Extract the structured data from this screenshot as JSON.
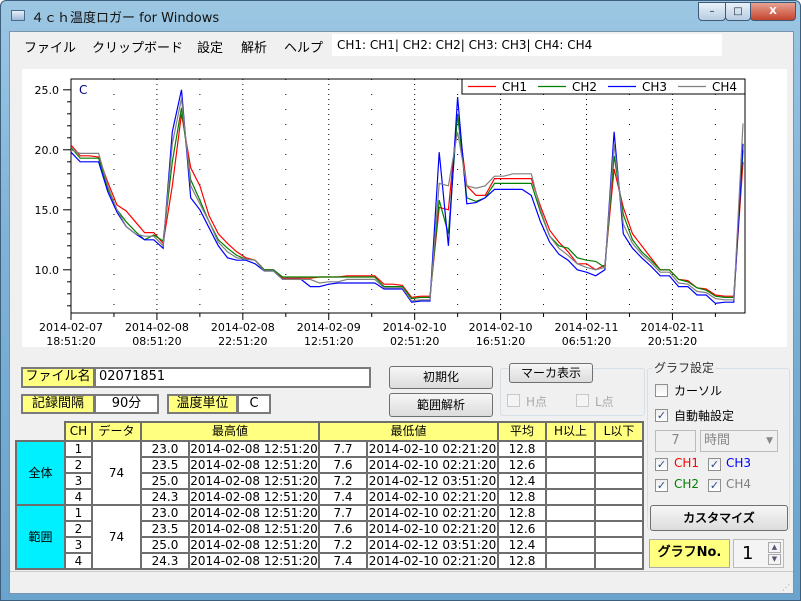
{
  "window": {
    "title": "４ｃｈ温度ロガー for Windows",
    "minimize": "–",
    "maximize": "□",
    "close": "X"
  },
  "menu": {
    "items": [
      "ファイル",
      "クリップボード",
      "設定",
      "解析",
      "ヘルプ"
    ],
    "channel_info": "CH1: CH1| CH2: CH2| CH3: CH3| CH4: CH4"
  },
  "chart_data": {
    "type": "line",
    "ylabel": "C",
    "ylim": [
      6.4,
      25.9
    ],
    "yticks": [
      "25.0",
      "20.0",
      "15.0",
      "10.0"
    ],
    "ytick_values": [
      25,
      20,
      15,
      10
    ],
    "x_start": "2014-02-07 18:51:20",
    "interval_minutes": 90,
    "xticks": [
      [
        "2014-02-07",
        "18:51:20"
      ],
      [
        "2014-02-08",
        "08:51:20"
      ],
      [
        "2014-02-08",
        "22:51:20"
      ],
      [
        "2014-02-09",
        "12:51:20"
      ],
      [
        "2014-02-10",
        "02:51:20"
      ],
      [
        "2014-02-10",
        "16:51:20"
      ],
      [
        "2014-02-11",
        "06:51:20"
      ],
      [
        "2014-02-11",
        "20:51:20"
      ]
    ],
    "grid": "vertical dotted",
    "legend": "top-right",
    "series": [
      {
        "name": "CH1",
        "color": "#ff0000",
        "values": [
          20.4,
          19.5,
          19.5,
          19.4,
          17.3,
          15.4,
          14.9,
          14.0,
          13.1,
          13.1,
          12.2,
          17.0,
          23.0,
          18.5,
          17.0,
          14.5,
          13.0,
          12.2,
          11.5,
          11.0,
          10.8,
          10.0,
          10.0,
          9.3,
          9.3,
          9.3,
          9.3,
          9.4,
          9.4,
          9.4,
          9.5,
          9.5,
          9.5,
          9.5,
          8.8,
          8.8,
          8.7,
          7.7,
          7.8,
          7.8,
          15.2,
          15.0,
          22.9,
          17.0,
          16.2,
          16.2,
          17.6,
          17.6,
          17.6,
          17.6,
          17.6,
          15.3,
          13.3,
          12.3,
          11.5,
          10.5,
          10.5,
          10.0,
          10.4,
          18.4,
          15.2,
          13.0,
          12.0,
          11.0,
          10.0,
          10.0,
          9.2,
          9.1,
          8.5,
          8.4,
          7.9,
          7.8,
          7.8,
          19.0
        ]
      },
      {
        "name": "CH2",
        "color": "#008000",
        "values": [
          20.2,
          19.3,
          19.3,
          19.3,
          16.8,
          15.0,
          14.0,
          13.2,
          12.5,
          12.9,
          12.4,
          19.0,
          23.5,
          17.5,
          15.8,
          14.0,
          12.5,
          11.8,
          11.2,
          10.9,
          10.8,
          10.0,
          10.0,
          9.4,
          9.4,
          9.4,
          9.4,
          9.4,
          9.4,
          9.4,
          9.4,
          9.4,
          9.4,
          9.4,
          8.6,
          8.6,
          8.6,
          7.6,
          7.7,
          7.7,
          15.8,
          13.0,
          23.0,
          16.0,
          15.7,
          16.0,
          17.2,
          17.2,
          17.2,
          17.2,
          17.2,
          14.8,
          12.8,
          12.0,
          11.8,
          11.0,
          10.8,
          10.7,
          10.2,
          19.5,
          14.6,
          12.5,
          11.5,
          10.8,
          10.0,
          10.0,
          9.2,
          9.0,
          8.5,
          8.3,
          7.8,
          7.7,
          7.7,
          20.0
        ]
      },
      {
        "name": "CH3",
        "color": "#0000ff",
        "values": [
          19.8,
          19.0,
          19.0,
          19.0,
          16.5,
          14.8,
          13.6,
          13.0,
          12.5,
          12.5,
          11.8,
          21.5,
          25.0,
          16.0,
          15.0,
          13.5,
          12.0,
          11.0,
          10.8,
          10.8,
          10.5,
          9.9,
          9.9,
          9.2,
          9.2,
          9.2,
          8.6,
          8.6,
          8.8,
          8.9,
          8.9,
          8.9,
          8.9,
          8.9,
          8.4,
          8.4,
          8.4,
          7.3,
          7.4,
          7.4,
          19.8,
          12.0,
          24.4,
          15.5,
          15.6,
          16.0,
          16.7,
          16.7,
          16.7,
          16.7,
          16.2,
          14.0,
          12.3,
          11.3,
          10.8,
          10.0,
          9.8,
          9.5,
          10.0,
          21.5,
          13.0,
          11.8,
          11.0,
          10.3,
          9.5,
          9.5,
          8.6,
          8.6,
          7.9,
          7.9,
          7.2,
          7.3,
          7.3,
          20.5
        ]
      },
      {
        "name": "CH4",
        "color": "#808080",
        "values": [
          20.0,
          19.7,
          19.7,
          19.7,
          17.0,
          15.0,
          13.6,
          13.0,
          12.8,
          12.8,
          12.0,
          20.5,
          24.3,
          17.0,
          15.5,
          14.0,
          12.3,
          11.5,
          11.0,
          10.9,
          10.8,
          9.9,
          9.9,
          9.2,
          9.2,
          9.2,
          9.2,
          8.9,
          9.0,
          9.0,
          9.2,
          9.2,
          9.2,
          9.2,
          8.5,
          8.5,
          8.5,
          7.4,
          7.5,
          7.5,
          17.2,
          17.0,
          21.5,
          17.0,
          16.8,
          17.0,
          17.8,
          17.8,
          18.0,
          18.0,
          18.0,
          15.0,
          12.8,
          11.8,
          11.2,
          10.5,
          10.2,
          10.0,
          10.2,
          20.5,
          13.8,
          12.2,
          11.3,
          10.6,
          9.8,
          9.8,
          8.9,
          8.8,
          8.2,
          8.1,
          7.6,
          7.5,
          7.5,
          22.2
        ]
      }
    ]
  },
  "info": {
    "filename_label": "ファイル名",
    "filename": "02071851",
    "interval_label": "記録間隔",
    "interval": "90分",
    "unit_label": "温度単位",
    "unit": "C"
  },
  "buttons": {
    "init": "初期化",
    "range_analysis": "範囲解析",
    "marker": "マーカ表示",
    "customize": "カスタマイズ"
  },
  "marker": {
    "h_point": "H点",
    "l_point": "L点"
  },
  "graph_settings": {
    "title": "グラフ設定",
    "cursor": "カーソル",
    "cursor_checked": false,
    "auto_axis": "自動軸設定",
    "auto_axis_checked": true,
    "span_value": "7",
    "span_unit": "時間",
    "ch1": "CH1",
    "ch2": "CH2",
    "ch3": "CH3",
    "ch4": "CH4",
    "graph_no_label": "グラフNo.",
    "graph_no": "1"
  },
  "table": {
    "headers": {
      "ch": "CH",
      "data": "データ",
      "max": "最高値",
      "min": "最低値",
      "avg": "平均",
      "h_above": "H以上",
      "l_below": "L以下"
    },
    "groups": [
      {
        "label": "全体",
        "count": "74",
        "rows": [
          {
            "ch": "1",
            "max": "23.0",
            "max_time": "2014-02-08 12:51:20",
            "min": "7.7",
            "min_time": "2014-02-10 02:21:20",
            "avg": "12.8",
            "h": "",
            "l": ""
          },
          {
            "ch": "2",
            "max": "23.5",
            "max_time": "2014-02-08 12:51:20",
            "min": "7.6",
            "min_time": "2014-02-10 02:21:20",
            "avg": "12.6",
            "h": "",
            "l": ""
          },
          {
            "ch": "3",
            "max": "25.0",
            "max_time": "2014-02-08 12:51:20",
            "min": "7.2",
            "min_time": "2014-02-12 03:51:20",
            "avg": "12.4",
            "h": "",
            "l": ""
          },
          {
            "ch": "4",
            "max": "24.3",
            "max_time": "2014-02-08 12:51:20",
            "min": "7.4",
            "min_time": "2014-02-10 02:21:20",
            "avg": "12.8",
            "h": "",
            "l": ""
          }
        ]
      },
      {
        "label": "範囲",
        "count": "74",
        "rows": [
          {
            "ch": "1",
            "max": "23.0",
            "max_time": "2014-02-08 12:51:20",
            "min": "7.7",
            "min_time": "2014-02-10 02:21:20",
            "avg": "12.8",
            "h": "",
            "l": ""
          },
          {
            "ch": "2",
            "max": "23.5",
            "max_time": "2014-02-08 12:51:20",
            "min": "7.6",
            "min_time": "2014-02-10 02:21:20",
            "avg": "12.6",
            "h": "",
            "l": ""
          },
          {
            "ch": "3",
            "max": "25.0",
            "max_time": "2014-02-08 12:51:20",
            "min": "7.2",
            "min_time": "2014-02-12 03:51:20",
            "avg": "12.4",
            "h": "",
            "l": ""
          },
          {
            "ch": "4",
            "max": "24.3",
            "max_time": "2014-02-08 12:51:20",
            "min": "7.4",
            "min_time": "2014-02-10 02:21:20",
            "avg": "12.8",
            "h": "",
            "l": ""
          }
        ]
      }
    ]
  }
}
